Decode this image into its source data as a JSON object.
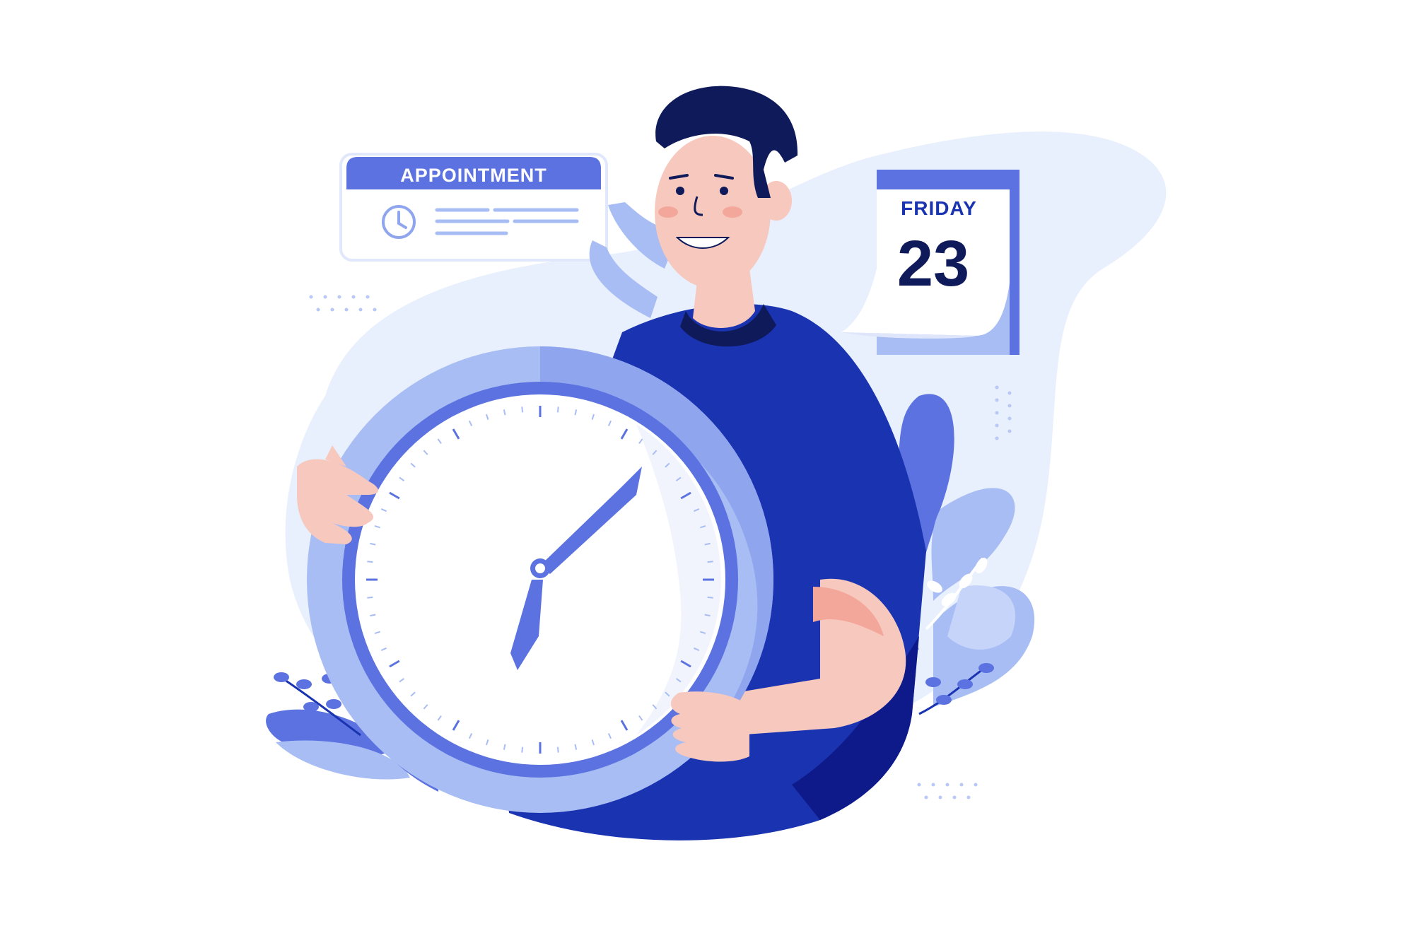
{
  "appointment_card": {
    "title": "APPOINTMENT",
    "icon": "clock-icon"
  },
  "calendar": {
    "day": "FRIDAY",
    "date": "23"
  },
  "clock": {
    "hour_hand": "about 7",
    "minute_hand": "about 7 minutes past"
  },
  "colors": {
    "primary": "#1a33b0",
    "accent": "#5b72e0",
    "light": "#a7bdf4",
    "pale": "#e8effd",
    "dark_navy": "#0f1a5a",
    "skin": "#f7c8bd"
  }
}
